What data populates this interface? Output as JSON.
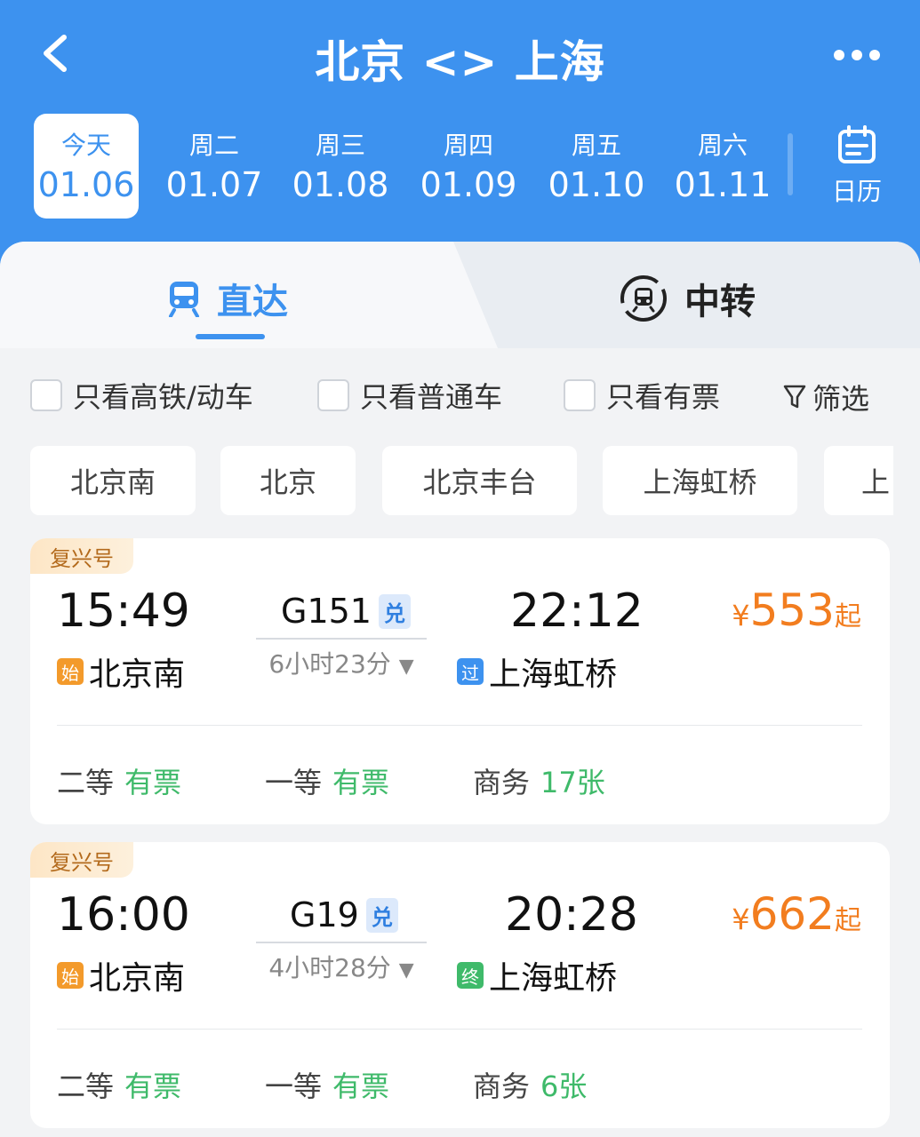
{
  "header": {
    "title": "北京 <> 上海"
  },
  "dates": [
    {
      "weekday": "今天",
      "date": "01.06",
      "active": true
    },
    {
      "weekday": "周二",
      "date": "01.07"
    },
    {
      "weekday": "周三",
      "date": "01.08"
    },
    {
      "weekday": "周四",
      "date": "01.09"
    },
    {
      "weekday": "周五",
      "date": "01.10"
    },
    {
      "weekday": "周六",
      "date": "01.11"
    }
  ],
  "calendar_label": "日历",
  "tabs": {
    "direct": "直达",
    "transfer": "中转"
  },
  "filters": {
    "high_speed": "只看高铁/动车",
    "normal": "只看普通车",
    "available": "只看有票",
    "filter_button": "筛选"
  },
  "stations": [
    "北京南",
    "北京",
    "北京丰台",
    "上海虹桥",
    "上"
  ],
  "trains": [
    {
      "brand": "复兴号",
      "dep_time": "15:49",
      "train_no": "G151",
      "badge": "兑",
      "arr_time": "22:12",
      "duration": "6小时23分",
      "dep_station_tag": "始",
      "dep_station": "北京南",
      "arr_station_tag": "过",
      "arr_station": "上海虹桥",
      "price_symbol": "¥",
      "price": "553",
      "price_suffix": "起",
      "seats": [
        {
          "class": "二等",
          "status": "有票"
        },
        {
          "class": "一等",
          "status": "有票"
        },
        {
          "class": "商务",
          "status": "17张"
        }
      ]
    },
    {
      "brand": "复兴号",
      "dep_time": "16:00",
      "train_no": "G19",
      "badge": "兑",
      "arr_time": "20:28",
      "duration": "4小时28分",
      "dep_station_tag": "始",
      "dep_station": "北京南",
      "arr_station_tag": "终",
      "arr_station": "上海虹桥",
      "price_symbol": "¥",
      "price": "662",
      "price_suffix": "起",
      "seats": [
        {
          "class": "二等",
          "status": "有票"
        },
        {
          "class": "一等",
          "status": "有票"
        },
        {
          "class": "商务",
          "status": "6张"
        }
      ]
    }
  ],
  "colors": {
    "primary": "#3d92ef",
    "price": "#f27d1f",
    "available": "#3fba6a",
    "tag_start": "#f39a2b",
    "tag_pass": "#3d92ef",
    "tag_end": "#3fba6a"
  }
}
